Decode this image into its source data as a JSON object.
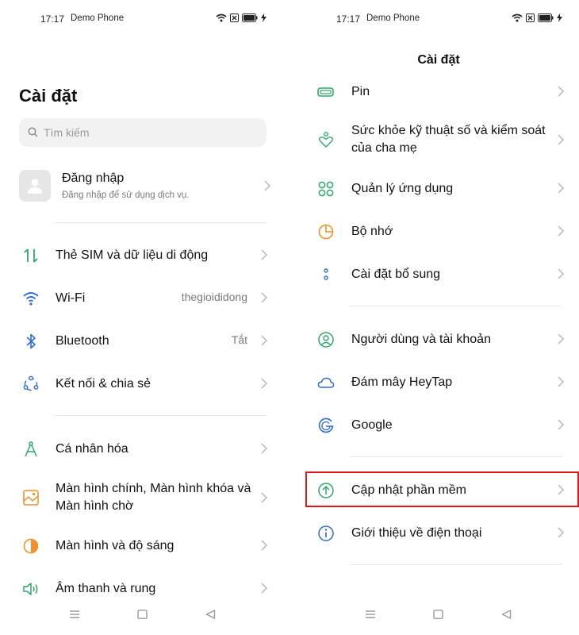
{
  "status": {
    "time": "17:17",
    "carrier": "Demo Phone"
  },
  "left": {
    "title": "Cài đặt",
    "search_placeholder": "Tìm kiếm",
    "login": {
      "title": "Đăng nhập",
      "subtitle": "Đăng nhập để sử dụng dịch vụ."
    },
    "items": [
      {
        "label": "Thẻ SIM và dữ liệu di động",
        "value": "",
        "icon": "sim-data-icon"
      },
      {
        "label": "Wi-Fi",
        "value": "thegioididong",
        "icon": "wifi-icon"
      },
      {
        "label": "Bluetooth",
        "value": "Tắt",
        "icon": "bluetooth-icon"
      },
      {
        "label": "Kết nối & chia sẻ",
        "value": "",
        "icon": "share-icon"
      },
      {
        "label": "Cá nhân hóa",
        "value": "",
        "icon": "compass-icon"
      },
      {
        "label": "Màn hình chính, Màn hình khóa và Màn hình chờ",
        "value": "",
        "icon": "wallpaper-icon"
      },
      {
        "label": "Màn hình và độ sáng",
        "value": "",
        "icon": "brightness-icon"
      },
      {
        "label": "Âm thanh và rung",
        "value": "",
        "icon": "speaker-icon"
      }
    ]
  },
  "right": {
    "title": "Cài đặt",
    "items": [
      {
        "label": "Pin",
        "icon": "battery-icon"
      },
      {
        "label": "Sức khỏe kỹ thuật số và kiểm soát của cha mẹ",
        "icon": "digital-wellbeing-icon"
      },
      {
        "label": "Quản lý ứng dụng",
        "icon": "apps-icon"
      },
      {
        "label": "Bộ nhớ",
        "icon": "storage-icon"
      },
      {
        "label": "Cài đặt bổ sung",
        "icon": "more-settings-icon"
      },
      {
        "label": "Người dùng và tài khoản",
        "icon": "user-icon"
      },
      {
        "label": "Đám mây HeyTap",
        "icon": "cloud-icon"
      },
      {
        "label": "Google",
        "icon": "google-icon"
      },
      {
        "label": "Cập nhật phần mềm",
        "icon": "software-update-icon"
      },
      {
        "label": "Giới thiệu về điện thoại",
        "icon": "info-icon"
      }
    ]
  },
  "colors": {
    "highlight": "#e01818",
    "green": "#2ea86a",
    "blue": "#2f6bd6",
    "orange": "#f0922b"
  }
}
